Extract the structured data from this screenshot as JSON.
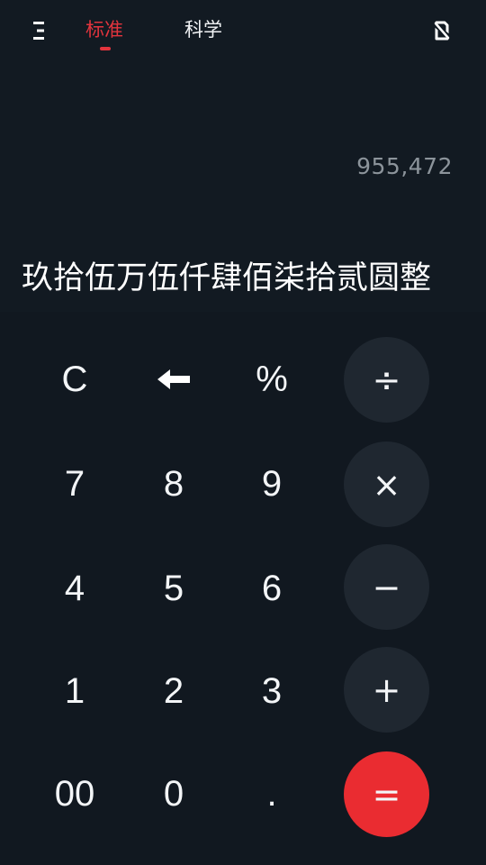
{
  "header": {
    "menu_icon": "menu-icon",
    "tabs": [
      {
        "label": "标准",
        "active": true
      },
      {
        "label": "科学",
        "active": false
      }
    ],
    "float_icon": "floating-window-icon",
    "accent_color": "#e2343d"
  },
  "display": {
    "expression": "955,472",
    "result_text": "玖拾伍万伍仟肆佰柒拾贰圆整"
  },
  "keypad": {
    "rows": [
      [
        "C",
        "backspace-icon",
        "%",
        "÷"
      ],
      [
        "7",
        "8",
        "9",
        "×"
      ],
      [
        "4",
        "5",
        "6",
        "−"
      ],
      [
        "1",
        "2",
        "3",
        "+"
      ],
      [
        "00",
        "0",
        ".",
        "="
      ]
    ],
    "labels": {
      "clear": "C",
      "percent": "%",
      "divide": "÷",
      "multiply": "×",
      "minus": "−",
      "plus": "+",
      "equals": "=",
      "d7": "7",
      "d8": "8",
      "d9": "9",
      "d4": "4",
      "d5": "5",
      "d6": "6",
      "d1": "1",
      "d2": "2",
      "d3": "3",
      "d00": "00",
      "d0": "0",
      "dot": "."
    },
    "equals_color": "#ea2c31"
  }
}
